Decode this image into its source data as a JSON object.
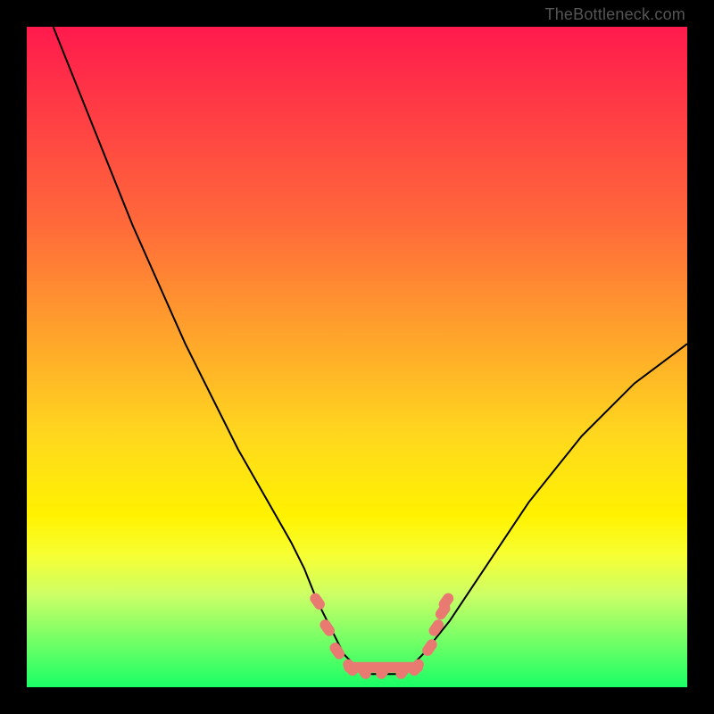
{
  "watermark": "TheBottleneck.com",
  "chart_data": {
    "type": "line",
    "title": "",
    "xlabel": "",
    "ylabel": "",
    "xlim": [
      0,
      100
    ],
    "ylim": [
      0,
      100
    ],
    "x": [
      4,
      8,
      12,
      16,
      20,
      24,
      28,
      32,
      36,
      40,
      42,
      44,
      46,
      48,
      50,
      52,
      54,
      56,
      58,
      60,
      64,
      68,
      72,
      76,
      80,
      84,
      88,
      92,
      96,
      100
    ],
    "values": [
      100,
      90,
      80,
      70,
      61,
      52,
      44,
      36,
      29,
      22,
      18,
      13,
      9,
      5,
      3,
      2,
      2,
      2,
      3,
      5,
      10,
      16,
      22,
      28,
      33,
      38,
      42,
      46,
      49,
      52
    ],
    "flat_segment": {
      "x_start": 48,
      "x_end": 60,
      "y": 3
    },
    "markers": [
      {
        "x": 44,
        "y": 13
      },
      {
        "x": 45.5,
        "y": 9
      },
      {
        "x": 47,
        "y": 5.5
      },
      {
        "x": 49,
        "y": 3
      },
      {
        "x": 51,
        "y": 2.5
      },
      {
        "x": 54,
        "y": 2.5
      },
      {
        "x": 57,
        "y": 2.5
      },
      {
        "x": 59,
        "y": 3
      },
      {
        "x": 61,
        "y": 6
      },
      {
        "x": 62,
        "y": 9
      },
      {
        "x": 63,
        "y": 11.5
      },
      {
        "x": 63.5,
        "y": 13
      }
    ],
    "marker_color": "#e97a72",
    "curve_color": "#000000"
  }
}
